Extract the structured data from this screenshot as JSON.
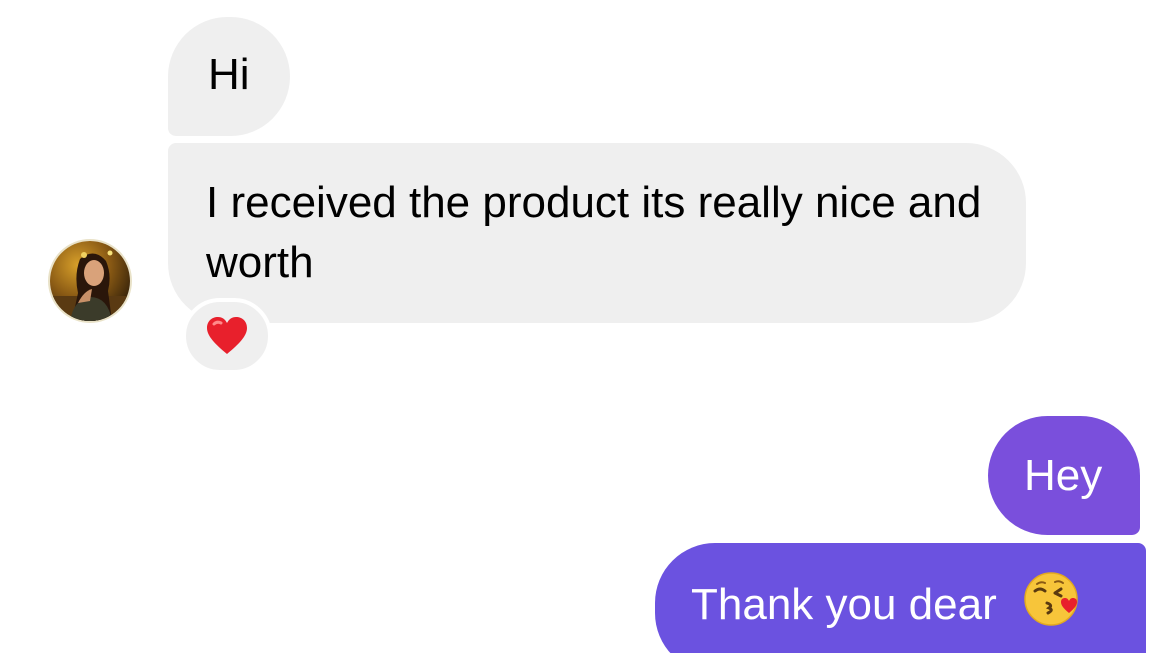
{
  "thread": {
    "messages": [
      {
        "sender": "them",
        "text": "Hi"
      },
      {
        "sender": "them",
        "text": "I received the product its really nice and worth",
        "reaction_icon": "red-heart-icon"
      },
      {
        "sender": "me",
        "text": "Hey"
      },
      {
        "sender": "me",
        "text": "Thank you dear",
        "trailing_icon": "face-blowing-kiss-icon"
      }
    ]
  },
  "colors": {
    "incoming_bubble": "#efefef",
    "outgoing_bubble_top": "#7a4fdc",
    "outgoing_bubble_bottom": "#6b52e0",
    "outgoing_text": "#ffffff",
    "incoming_text": "#000000"
  }
}
